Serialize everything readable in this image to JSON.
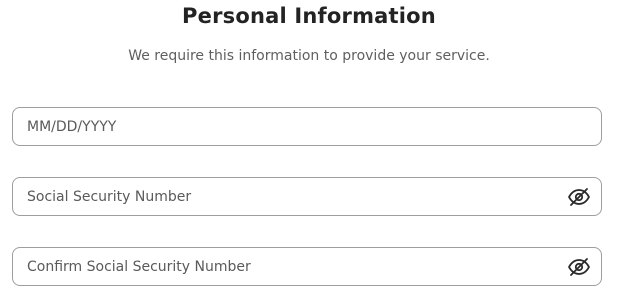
{
  "header": {
    "title": "Personal Information",
    "subtitle": "We require this information to provide your service."
  },
  "form": {
    "dob": {
      "placeholder": "MM/DD/YYYY",
      "value": ""
    },
    "ssn": {
      "placeholder": "Social Security Number",
      "value": "",
      "toggle_icon": "eye-slash-icon"
    },
    "ssn_confirm": {
      "placeholder": "Confirm Social Security Number",
      "value": "",
      "toggle_icon": "eye-slash-icon"
    }
  },
  "colors": {
    "border": "#9e9e9e",
    "title": "#232323",
    "subtitle": "#5f5f5f",
    "icon": "#2a2a2a"
  }
}
